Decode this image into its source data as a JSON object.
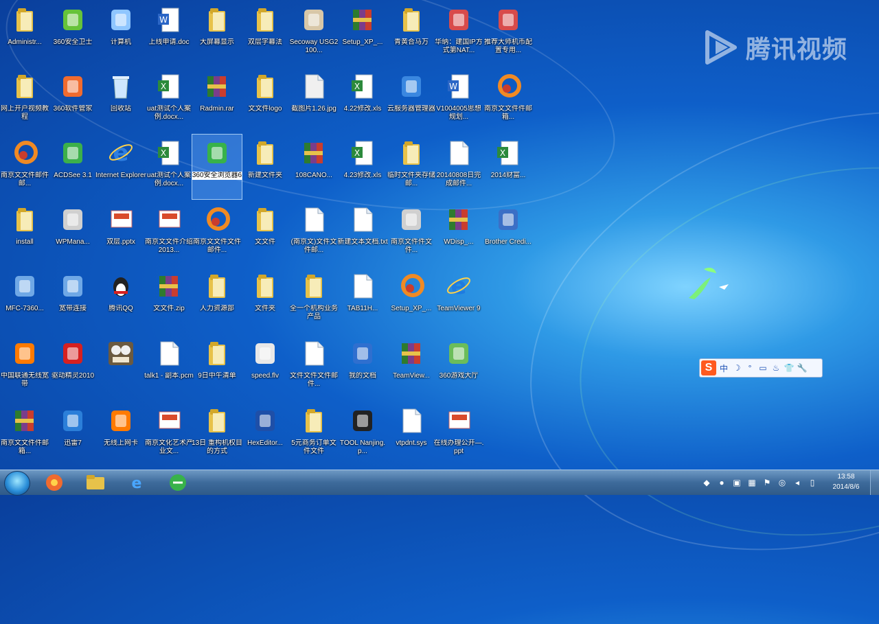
{
  "watermark": {
    "text": "腾讯视频"
  },
  "desktop_icons": [
    {
      "label": "Administr...",
      "icon": "user-folder-icon",
      "color": "#e7c24a"
    },
    {
      "label": "360安全卫士",
      "icon": "360-safe-icon",
      "color": "#66c33a"
    },
    {
      "label": "计算机",
      "icon": "computer-icon",
      "color": "#8fc6ff"
    },
    {
      "label": "上线申请.doc",
      "icon": "word-doc-icon",
      "color": "#2b66c6"
    },
    {
      "label": "大屏幕显示",
      "icon": "folder-icon",
      "color": "#e7c24a"
    },
    {
      "label": "双层字幕法",
      "icon": "folder-icon",
      "color": "#e7c24a"
    },
    {
      "label": "Secoway USG2100...",
      "icon": "setup-icon",
      "color": "#d8c7a8"
    },
    {
      "label": "Setup_XP_...",
      "icon": "winrar-icon",
      "color": "#7a3d8b"
    },
    {
      "label": "青黄合马万",
      "icon": "folder-icon",
      "color": "#e7c24a"
    },
    {
      "label": "华纳：建国IP方式第NAT...",
      "icon": "document-icon",
      "color": "#d84b4b"
    },
    {
      "label": "推荐大师机币配置专用...",
      "icon": "document-icon",
      "color": "#d84b4b"
    },
    {
      "label": "网上开户视频教程",
      "icon": "folder-icon",
      "color": "#e7c24a"
    },
    {
      "label": "360软件管家",
      "icon": "360-manager-icon",
      "color": "#f06b2f"
    },
    {
      "label": "回收站",
      "icon": "recycle-bin-icon",
      "color": "#cfe7ff"
    },
    {
      "label": "uat测试个人案例.docx...",
      "icon": "excel-icon",
      "color": "#2c8a3c"
    },
    {
      "label": "Radmin.rar",
      "icon": "winrar-icon",
      "color": "#7a3d8b"
    },
    {
      "label": "文文件logo",
      "icon": "folder-icon",
      "color": "#e7c24a"
    },
    {
      "label": "截图片1.26.jpg",
      "icon": "image-icon",
      "color": "#f0f0f0"
    },
    {
      "label": "4.22修改.xls",
      "icon": "excel-icon",
      "color": "#2c8a3c"
    },
    {
      "label": "云服务器管理器",
      "icon": "cloud-app-icon",
      "color": "#3a87e0"
    },
    {
      "label": "V1004005思想规划...",
      "icon": "word-doc-icon",
      "color": "#2b66c6"
    },
    {
      "label": "南京文文件件邮箱...",
      "icon": "orange-swirl-icon",
      "color": "#f08a24"
    },
    {
      "label": "南京文文件邮件邮...",
      "icon": "orange-swirl-icon",
      "color": "#f08a24"
    },
    {
      "label": "ACDSee 3.1",
      "icon": "acdsee-icon",
      "color": "#3cb04a"
    },
    {
      "label": "Internet Explorer",
      "icon": "ie-icon",
      "color": "#2f7fe0"
    },
    {
      "label": "uat测试个人案例.docx...",
      "icon": "excel-icon",
      "color": "#2c8a3c"
    },
    {
      "label": "360安全浏览器6",
      "icon": "360-browser-icon",
      "color": "#38b24a"
    },
    {
      "label": "新建文件夹",
      "icon": "folder-icon",
      "color": "#e7c24a"
    },
    {
      "label": "108CANO...",
      "icon": "winrar-icon",
      "color": "#7a3d8b"
    },
    {
      "label": "4.23修改.xls",
      "icon": "excel-icon",
      "color": "#2c8a3c"
    },
    {
      "label": "临时文件夹存储邮...",
      "icon": "folder-icon",
      "color": "#e7c24a"
    },
    {
      "label": "20140808日完成邮件...",
      "icon": "blank-file-icon",
      "color": "#ffffff"
    },
    {
      "label": "2014财富...",
      "icon": "excel-icon",
      "color": "#2c8a3c"
    },
    {
      "label": "install",
      "icon": "folder-icon",
      "color": "#e7c24a"
    },
    {
      "label": "WPMana...",
      "icon": "server-icon",
      "color": "#d0d0d0"
    },
    {
      "label": "双层.pptx",
      "icon": "ppt-icon",
      "color": "#d94b2b"
    },
    {
      "label": "南京文文件介绍2013...",
      "icon": "ppt-icon",
      "color": "#d94b2b"
    },
    {
      "label": "南京文文件文件邮件...",
      "icon": "orange-swirl-icon",
      "color": "#f08a24"
    },
    {
      "label": "文文件",
      "icon": "folder-icon",
      "color": "#e7c24a"
    },
    {
      "label": "(南京文)文件文件邮...",
      "icon": "blank-file-icon",
      "color": "#ffffff"
    },
    {
      "label": "新建文本文档.txt",
      "icon": "text-file-icon",
      "color": "#ffffff"
    },
    {
      "label": "南京文件件文件...",
      "icon": "server-icon",
      "color": "#d0d0d0"
    },
    {
      "label": "WDisp_...",
      "icon": "winrar-icon",
      "color": "#7a3d8b"
    },
    {
      "label": "Brother Credi...",
      "icon": "brother-icon",
      "color": "#3b6fc6"
    },
    {
      "label": "MFC-7360...",
      "icon": "printer-icon",
      "color": "#6fa8e6"
    },
    {
      "label": "宽带连接",
      "icon": "network-icon",
      "color": "#6fa8e6"
    },
    {
      "label": "腾讯QQ",
      "icon": "qq-penguin-icon",
      "color": "#222222"
    },
    {
      "label": "文文件.zip",
      "icon": "winrar-icon",
      "color": "#7a3d8b"
    },
    {
      "label": "人力资源部",
      "icon": "folder-icon",
      "color": "#e7c24a"
    },
    {
      "label": "文件夹",
      "icon": "folder-icon",
      "color": "#e7c24a"
    },
    {
      "label": "全一个机构业务产品",
      "icon": "folder-icon",
      "color": "#e7c24a"
    },
    {
      "label": "TAB11H...",
      "icon": "blank-file-icon",
      "color": "#ffffff"
    },
    {
      "label": "Setup_XP_...",
      "icon": "orange-swirl-icon",
      "color": "#f08a24"
    },
    {
      "label": "TeamViewer 9",
      "icon": "teamviewer-icon",
      "color": "#1e7be0"
    },
    {
      "label": "中国联通无线宽带",
      "icon": "unicom-icon",
      "color": "#ff7a00"
    },
    {
      "label": "驱动精灵2010",
      "icon": "driver-icon",
      "color": "#d62020"
    },
    {
      "label": "",
      "icon": "video-player-icon",
      "color": "#6b5a40"
    },
    {
      "label": "talk1 - 副本.pcm",
      "icon": "blank-file-icon",
      "color": "#ffffff"
    },
    {
      "label": "9日中午清单",
      "icon": "folder-icon",
      "color": "#e7c24a"
    },
    {
      "label": "speed.flv",
      "icon": "flv-icon",
      "color": "#e8e8e8"
    },
    {
      "label": "文件文件文件邮件...",
      "icon": "blank-file-icon",
      "color": "#ffffff"
    },
    {
      "label": "我的文档",
      "icon": "documents-icon",
      "color": "#2f6fcf"
    },
    {
      "label": "TeamView...",
      "icon": "winrar-icon",
      "color": "#7a3d8b"
    },
    {
      "label": "360游戏大厅",
      "icon": "gamepad-icon",
      "color": "#6bbd5a"
    },
    {
      "label": "南京文文件件邮箱...",
      "icon": "winrar-icon",
      "color": "#7a3d8b"
    },
    {
      "label": "迅雷7",
      "icon": "thunder-icon",
      "color": "#2b7fd9"
    },
    {
      "label": "无线上网卡",
      "icon": "unicom-icon",
      "color": "#ff7a00"
    },
    {
      "label": "南京文化艺术产业文...",
      "icon": "ppt-icon",
      "color": "#d94b2b"
    },
    {
      "label": "13日 重构机权目的方式",
      "icon": "folder-icon",
      "color": "#e7c24a"
    },
    {
      "label": "HexEditor...",
      "icon": "hex-editor-icon",
      "color": "#1e4fa8"
    },
    {
      "label": "5元商务订单文件文件",
      "icon": "folder-icon",
      "color": "#e7c24a"
    },
    {
      "label": "TOOL Nanjing.p...",
      "icon": "tool-icon",
      "color": "#222222"
    },
    {
      "label": "vtpdnt.sys",
      "icon": "blank-file-icon",
      "color": "#ffffff"
    },
    {
      "label": "在线办理公开—.ppt",
      "icon": "ppt-icon",
      "color": "#d94b2b"
    }
  ],
  "ime_bar": {
    "logo": "S",
    "items": [
      "中",
      "☽",
      "°",
      "▭",
      "♨",
      "👕",
      "🔧"
    ]
  },
  "taskbar": {
    "start": "start-orb",
    "pinned": [
      {
        "name": "360-manager-taskbar-icon",
        "color": "#f06b2f"
      },
      {
        "name": "explorer-taskbar-icon",
        "color": "#e7c24a"
      },
      {
        "name": "ie-taskbar-icon",
        "color": "#2f7fe0"
      },
      {
        "name": "360-browser-taskbar-icon",
        "color": "#38b24a"
      }
    ],
    "clock_time": "13:58",
    "clock_date": "2014/8/6"
  }
}
